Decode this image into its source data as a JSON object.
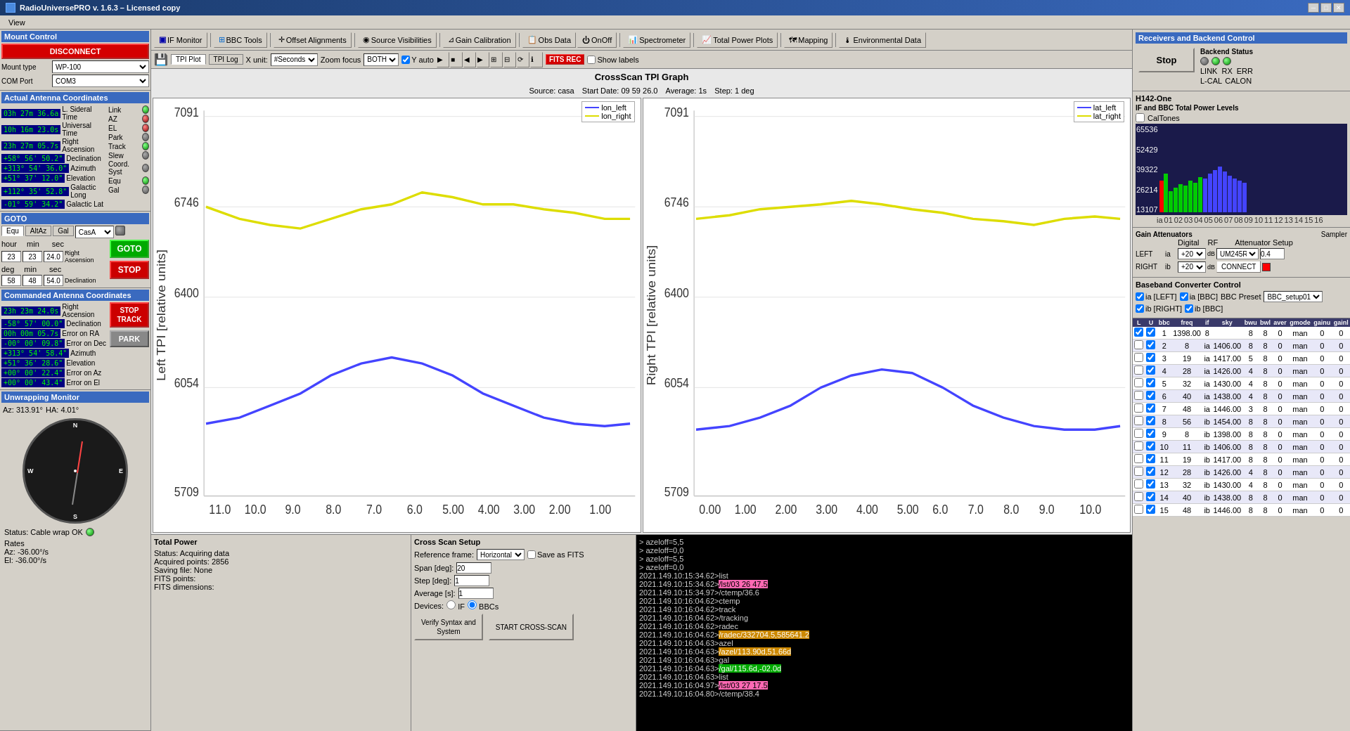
{
  "window": {
    "title": "RadioUniversePRO v. 1.6.3 – Licensed copy",
    "close_label": "✕",
    "maximize_label": "□",
    "minimize_label": "─"
  },
  "menu": {
    "items": [
      "View"
    ]
  },
  "mount_control": {
    "label": "Mount Control",
    "disconnect_label": "DISCONNECT",
    "mount_type_label": "Mount type",
    "mount_type_value": "WP-100",
    "com_port_label": "COM Port",
    "com_port_value": "COM3"
  },
  "indicators": {
    "link": "Link",
    "az": "AZ",
    "el": "EL",
    "park": "Park",
    "track": "Track",
    "slew": "Slew",
    "coord_syst": "Coord. Syst",
    "equ": "Equ",
    "gal": "Gal"
  },
  "actual_coords": {
    "label": "Actual Antenna Coordinates",
    "ra": "03h 27m 36.6a",
    "ra_label": "L. Sideral Time",
    "ut": "10h 16m 23.0s",
    "ut_label": "Universal Time",
    "ra2": "23h 27m 05.7s",
    "ra2_label": "Right Ascension",
    "dec": "+58° 56' 50.2\"",
    "dec_label": "Declination",
    "az": "+313° 54' 36.0\"",
    "az_label": "Azimuth",
    "el": "+51° 37' 12.0\"",
    "el_label": "Elevation",
    "gal_long": "+112° 35' 52.8\"",
    "gal_long_label": "Galactic Long",
    "gal_lat": "-01° 59' 34.2\"",
    "gal_lat_label": "Galactic Lat"
  },
  "goto_section": {
    "label": "GOTO",
    "tabs": [
      "Equ",
      "AltAz",
      "Gal"
    ],
    "source_value": "CasA",
    "coord_labels": [
      "hour",
      "min",
      "sec",
      "deg",
      "min",
      "sec"
    ],
    "coord_values": [
      "23",
      "23",
      "24.0",
      "58",
      "48",
      "54.0"
    ],
    "ra_label": "Right Ascension",
    "dec_label": "Declination",
    "goto_label": "GOTO",
    "stop_label": "STOP"
  },
  "commanded_coords": {
    "label": "Commanded Antenna Coordinates",
    "ra": "23h 23m 24.0s",
    "ra_label": "Right Ascension",
    "dec": "-58° 57' 00.0\"",
    "dec_label": "Declination",
    "error_ra": "00h 00m 05.7s",
    "error_ra_label": "Error on RA",
    "error_dec": "-00° 00' 09.8\"",
    "error_dec_label": "Error on Dec",
    "az": "+313° 54' 58.4\"",
    "az_label": "Azimuth",
    "el": "+51° 36' 28.6\"",
    "el_label": "Elevation",
    "error_az": "+00° 00' 22.4\"",
    "error_az_label": "Error on Az",
    "error_el": "+00° 00' 43.4\"",
    "error_el_label": "Error on El",
    "stop_track_label": "STOP\nTRACK",
    "park_label": "PARK"
  },
  "unwrapping": {
    "label": "Unwrapping Monitor",
    "az": "Az: 313.91°",
    "ha": "HA: 4.01°",
    "compass_labels": [
      "N",
      "S",
      "E",
      "W"
    ],
    "status": "Status: Cable wrap OK",
    "rates_label": "Rates",
    "rate_az": "Az: -36.00°/s",
    "rate_el": "El: -36.00°/s"
  },
  "toolbar_main": {
    "if_monitor": "IF Monitor",
    "bbc_tools": "BBC Tools",
    "offset_align": "Offset Alignments",
    "source_vis": "Source Visibilities",
    "gain_calib": "Gain Calibration",
    "obs_data": "Obs Data",
    "on_off": "OnOff",
    "spectrometer": "Spectrometer",
    "total_power": "Total Power Plots",
    "mapping": "Mapping",
    "env_data": "Environmental Data"
  },
  "tpi_toolbar": {
    "tpi_plot_label": "TPI Plot",
    "tpi_log_label": "TPI Log",
    "x_unit_label": "X unit:",
    "x_unit_value": "#Seconds",
    "zoom_focus_label": "Zoom focus",
    "zoom_focus_value": "BOTH",
    "y_auto_label": "Y auto",
    "fits_rec_label": "FITS REC",
    "show_labels_label": "Show labels"
  },
  "graph": {
    "title": "CrossScan TPI Graph",
    "source": "casa",
    "start_date": "Start Date: 09 59 26.0",
    "average": "Average: 1s",
    "step": "Step: 1 deg",
    "left_legend": {
      "lon_left": "lon_left",
      "lon_right": "lon_right"
    },
    "right_legend": {
      "lat_left": "lat_left",
      "lat_right": "lat_right"
    },
    "y_axis_left": "Left TPI [relative units]",
    "y_axis_right": "Right TPI [relative units]",
    "y_values": [
      "7091",
      "6746",
      "6400",
      "6054",
      "5709"
    ],
    "x_values_left": [
      "11.0",
      "10.0",
      "9.0",
      "8.0",
      "7.0",
      "6.0",
      "5.00",
      "4.00",
      "3.00",
      "2.00",
      "1.00"
    ],
    "x_values_right": [
      "0.00",
      "1.00",
      "2.00",
      "3.00",
      "4.00",
      "5.00",
      "6.0",
      "7.0",
      "8.0",
      "9.0",
      "10.0"
    ]
  },
  "total_power": {
    "label": "Total Power",
    "status": "Status: Acquiring data",
    "acquired_points": "Acquired points: 2856",
    "saving_file": "Saving file: None",
    "fits_points": "FITS points:",
    "fits_dimensions": "FITS dimensions:"
  },
  "cross_scan": {
    "label": "Cross Scan Setup",
    "ref_frame_label": "Reference frame:",
    "ref_frame_value": "Horizontal",
    "save_as_fits_label": "Save as FITS",
    "span_label": "Span [deg]:",
    "span_value": "20",
    "step_label": "Step [deg]:",
    "step_value": "1",
    "average_label": "Average [s]:",
    "average_value": "1",
    "devices_label": "Devices:",
    "devices_if": "IF",
    "devices_bbcs": "BBCs",
    "verify_btn": "Verify Syntax and\nSystem",
    "start_scan_btn": "START CROSS-SCAN"
  },
  "terminal": {
    "lines": [
      "> azeloff=5,5",
      "> azeloff=0,0",
      "> azeloff=5,5",
      "> azeloff=0,0",
      "2021.149.10:15:34.62>list",
      "2021.149.10:15:34.62>/lst/03 26 47.5",
      "2021.149.10:15:34.97>/ctemp/36.6",
      "2021.149.10:16:04.62>ctemp",
      "2021.149.10:16:04.62>track",
      "2021.149.10:16:04.62>/tracking",
      "2021.149.10:16:04.62>radec",
      "2021.149.10:16:04.62>/radec/332704.5,585641.2",
      "2021.149.10:16:04.63>azel",
      "2021.149.10:16:04.63>/azel/113.90d,51.66d",
      "2021.149.10:16:04.63>gal",
      "2021.149.10:16:04.63>/gal/115.6d,-02.0d",
      "2021.149.10:16:04.63>list",
      "2021.149.10:16:04.97>/lst/03 27 17.5",
      "2021.149.10:16:04.80>/ctemp/38.4"
    ]
  },
  "backend_control": {
    "label": "Receivers and Backend Control",
    "stop_label": "Stop",
    "backend_status_label": "Backend Status",
    "leds": [
      "LINK",
      "RX",
      "ERR"
    ],
    "l_cal": "L-CAL",
    "calon": "CALON",
    "receiver_label": "H142-One",
    "if_bbc_label": "IF and BBC Total Power Levels",
    "cal_tones_label": "CalTones",
    "y_labels": [
      "65536",
      "52429",
      "39322",
      "26214",
      "13107"
    ],
    "x_labels": [
      "ia",
      "0 1",
      "0 2",
      "0 3",
      "0 4",
      "0 5",
      "0 6",
      "0 7",
      "0 8",
      "0 9",
      "10",
      "11",
      "12",
      "13",
      "14",
      "15",
      "16"
    ]
  },
  "gain_attenuators": {
    "label": "Gain Attenuators",
    "digital_label": "Digital",
    "rf_label": "RF",
    "attenuator_label": "Attenuator Setup",
    "sampler_label": "Sampler",
    "left_label": "LEFT",
    "left_ia": "ia",
    "left_digital": "+20",
    "left_rf_label": "dB",
    "left_setup": "UM245R",
    "left_sampler": "0.4",
    "right_label": "RIGHT",
    "right_ib": "ib",
    "right_digital": "+20",
    "right_rf_label": "dB",
    "connect_label": "CONNECT"
  },
  "baseband": {
    "label": "Baseband Converter Control",
    "ia_left_label": "ia [LEFT]",
    "ia_bbc_label": "ia [BBC]",
    "ib_right_label": "ib [RIGHT]",
    "ib_bbc_label": "ib [BBC]",
    "preset_label": "BBC Preset",
    "preset_value": "BBC_setup01",
    "table_headers": [
      "L",
      "U",
      "bbc",
      "freq",
      "if",
      "sky",
      "bwu",
      "bwl",
      "aver",
      "gmode",
      "gainu",
      "gainl"
    ],
    "rows": [
      [
        true,
        true,
        "1",
        "1398.00",
        "8",
        "",
        "8",
        "8",
        "0",
        "man",
        "0",
        "0"
      ],
      [
        false,
        true,
        "2",
        "8",
        "ia",
        "1406.00",
        "8",
        "8",
        "0",
        "man",
        "0",
        "0"
      ],
      [
        false,
        true,
        "3",
        "19",
        "ia",
        "1417.00",
        "5",
        "8",
        "0",
        "man",
        "0",
        "0"
      ],
      [
        false,
        true,
        "4",
        "28",
        "ia",
        "1426.00",
        "4",
        "8",
        "0",
        "man",
        "0",
        "0"
      ],
      [
        false,
        true,
        "5",
        "32",
        "ia",
        "1430.00",
        "4",
        "8",
        "0",
        "man",
        "0",
        "0"
      ],
      [
        false,
        true,
        "6",
        "40",
        "ia",
        "1438.00",
        "4",
        "8",
        "0",
        "man",
        "0",
        "0"
      ],
      [
        false,
        true,
        "7",
        "48",
        "ia",
        "1446.00",
        "3",
        "8",
        "0",
        "man",
        "0",
        "0"
      ],
      [
        false,
        true,
        "8",
        "56",
        "ib",
        "1454.00",
        "8",
        "8",
        "0",
        "man",
        "0",
        "0"
      ],
      [
        false,
        true,
        "9",
        "8",
        "ib",
        "1398.00",
        "8",
        "8",
        "0",
        "man",
        "0",
        "0"
      ],
      [
        false,
        true,
        "10",
        "11",
        "ib",
        "1406.00",
        "8",
        "8",
        "0",
        "man",
        "0",
        "0"
      ],
      [
        false,
        true,
        "11",
        "19",
        "ib",
        "1417.00",
        "8",
        "8",
        "0",
        "man",
        "0",
        "0"
      ],
      [
        false,
        true,
        "12",
        "28",
        "ib",
        "1426.00",
        "4",
        "8",
        "0",
        "man",
        "0",
        "0"
      ],
      [
        false,
        true,
        "13",
        "32",
        "ib",
        "1430.00",
        "4",
        "8",
        "0",
        "man",
        "0",
        "0"
      ],
      [
        false,
        true,
        "14",
        "40",
        "ib",
        "1438.00",
        "8",
        "8",
        "0",
        "man",
        "0",
        "0"
      ],
      [
        false,
        true,
        "15",
        "48",
        "ib",
        "1446.00",
        "8",
        "8",
        "0",
        "man",
        "0",
        "0"
      ]
    ]
  }
}
